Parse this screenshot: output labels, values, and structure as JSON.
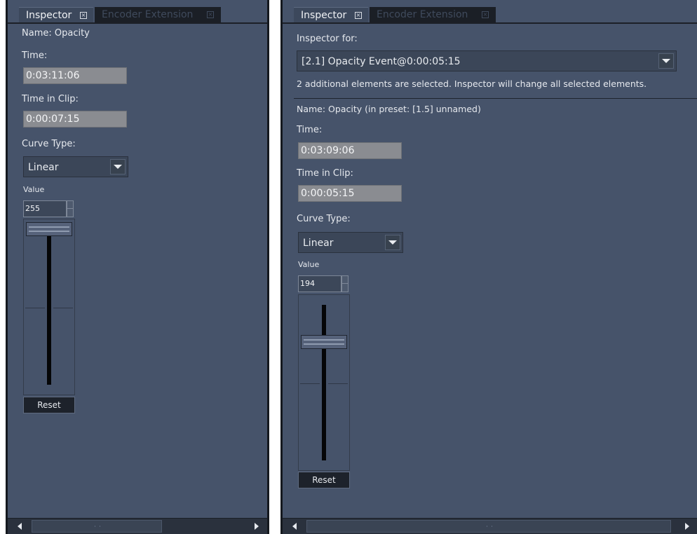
{
  "left": {
    "tabs": {
      "inspector": "Inspector",
      "encoder": "Encoder Extension"
    },
    "name_text": "Name: Opacity",
    "time_label": "Time:",
    "time_value": "0:03:11:06",
    "time_in_clip_label": "Time in Clip:",
    "time_in_clip_value": "0:00:07:15",
    "curve_type_label": "Curve Type:",
    "curve_type_value": "Linear",
    "value_label": "Value",
    "value": "255",
    "slider_level": 1.0,
    "reset_label": "Reset"
  },
  "right": {
    "tabs": {
      "inspector": "Inspector",
      "encoder": "Encoder Extension"
    },
    "inspector_for_label": "Inspector for:",
    "inspector_for_value": "[2.1] Opacity Event@0:00:05:15",
    "info_text": "2 additional elements are selected. Inspector will change all selected elements.",
    "name_text": "Name: Opacity (in preset: [1.5] unnamed)",
    "time_label": "Time:",
    "time_value": "0:03:09:06",
    "time_in_clip_label": "Time in Clip:",
    "time_in_clip_value": "0:00:05:15",
    "curve_type_label": "Curve Type:",
    "curve_type_value": "Linear",
    "value_label": "Value",
    "value": "194",
    "slider_level": 0.76,
    "reset_label": "Reset"
  },
  "icons": {
    "tab_close": "close-box-icon",
    "dropdown": "chevron-down-icon",
    "scroll_left": "arrow-left-icon",
    "scroll_right": "arrow-right-icon"
  },
  "colors": {
    "panel_bg": "#46536a",
    "field_bg": "#8a8c91",
    "tab_inactive": "#1b1f26"
  }
}
